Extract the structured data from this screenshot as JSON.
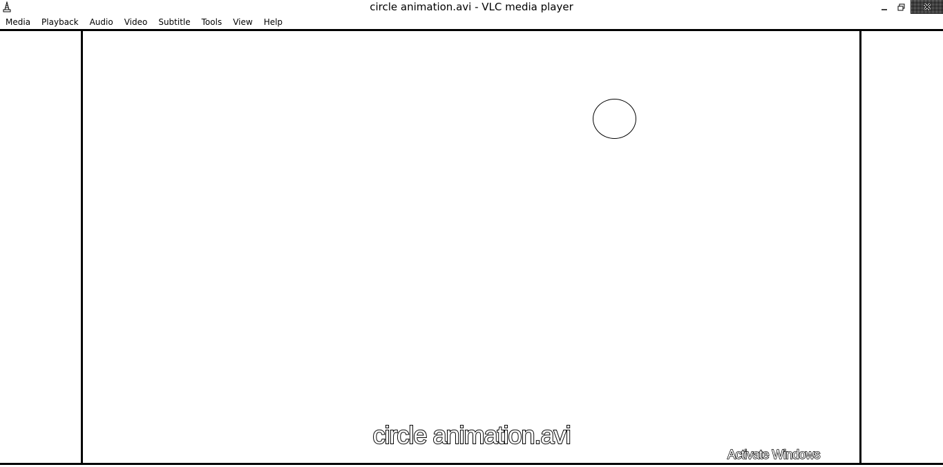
{
  "window": {
    "title": "circle animation.avi - VLC media player",
    "app_icon": "vlc-cone-icon",
    "controls": {
      "minimize_icon": "minimize-icon",
      "maximize_icon": "restore-icon",
      "close_icon": "close-icon"
    }
  },
  "menubar": {
    "items": [
      {
        "label": "Media"
      },
      {
        "label": "Playback"
      },
      {
        "label": "Audio"
      },
      {
        "label": "Video"
      },
      {
        "label": "Subtitle"
      },
      {
        "label": "Tools"
      },
      {
        "label": "View"
      },
      {
        "label": "Help"
      }
    ]
  },
  "video": {
    "osd_title": "circle animation.avi",
    "shape": "circle"
  },
  "watermark": {
    "text": "Activate Windows"
  },
  "colors": {
    "background": "#ffffff",
    "foreground": "#000000"
  }
}
